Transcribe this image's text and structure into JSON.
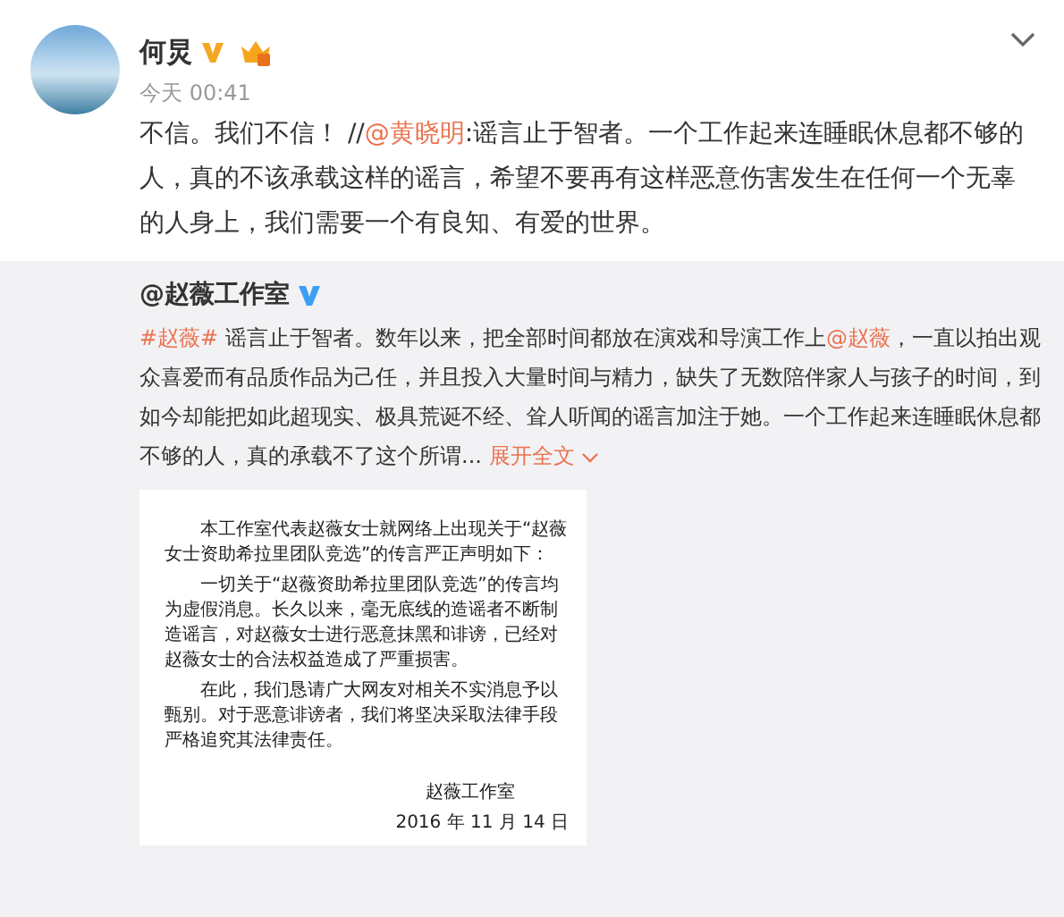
{
  "post": {
    "author": "何炅",
    "verified": true,
    "member": true,
    "time": "今天 00:41",
    "text": [
      {
        "kind": "plain",
        "text": "不信。我们不信！ //"
      },
      {
        "kind": "mention",
        "text": "@黄晓明"
      },
      {
        "kind": "plain",
        "text": ":谣言止于智者。一个工作起来连睡眠休息都不够的人，真的不该承载这样的谣言，希望不要再有这样恶意伤害发生在任何一个无辜的人身上，我们需要一个有良知、有爱的世界。"
      }
    ]
  },
  "repost": {
    "author": "@赵薇工作室",
    "verified": true,
    "text": [
      {
        "kind": "mention",
        "text": "#赵薇#"
      },
      {
        "kind": "plain",
        "text": " 谣言止于智者。数年以来，把全部时间都放在演戏和导演工作上"
      },
      {
        "kind": "mention",
        "text": "@赵薇"
      },
      {
        "kind": "plain",
        "text": "，一直以拍出观众喜爱而有品质作品为己任，并且投入大量时间与精力，缺失了无数陪伴家人与孩子的时间，到如今却能把如此超现实、极具荒诞不经、耸人听闻的谣言加注于她。一个工作起来连睡眠休息都不够的人，真的承载不了这个所谓..."
      }
    ],
    "expand": "展开全文",
    "document": {
      "paragraphs": [
        "本工作室代表赵薇女士就网络上出现关于“赵薇女士资助希拉里团队竞选”的传言严正声明如下：",
        "一切关于“赵薇资助希拉里团队竞选”的传言均为虚假消息。长久以来，毫无底线的造谣者不断制造谣言，对赵薇女士进行恶意抹黑和诽谤，已经对赵薇女士的合法权益造成了严重损害。",
        "在此，我们恳请广大网友对相关不实消息予以甄别。对于恶意诽谤者，我们将坚决采取法律手段严格追究其法律责任。"
      ],
      "signature": "赵薇工作室",
      "date": "2016 年 11 月 14 日"
    }
  }
}
